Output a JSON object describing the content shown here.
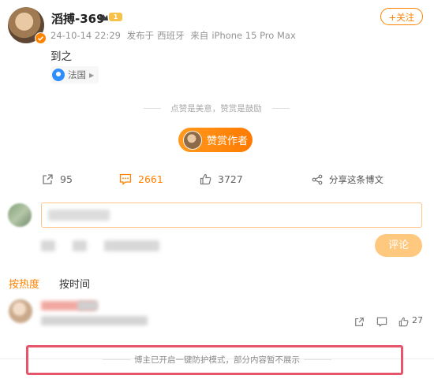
{
  "post": {
    "author": "滔搏-369",
    "level": "1",
    "time": "24-10-14 22:29",
    "published_at_label": "发布于",
    "published_at": "西班牙",
    "source_label": "来自",
    "source": "iPhone 15 Pro Max",
    "follow_label": "+关注",
    "text": "到之",
    "location": "法国"
  },
  "reward": {
    "tip": "点赞是美意，赞赏是鼓励",
    "button_label": "赞赏作者"
  },
  "actions": {
    "repost_count": "95",
    "comment_count": "2661",
    "like_count": "3727",
    "share_label": "分享这条博文"
  },
  "composer": {
    "submit_label": "评论"
  },
  "comment_tabs": {
    "by_hot": "按热度",
    "by_time": "按时间"
  },
  "comments": [
    {
      "like_count": "27"
    }
  ],
  "notice": "博主已开启一键防护模式，部分内容暂不展示",
  "colors": {
    "accent": "#ff8200",
    "highlight_box": "#e6556a"
  }
}
